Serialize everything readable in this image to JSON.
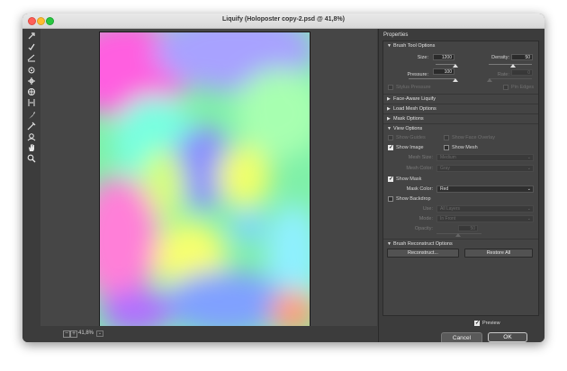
{
  "window": {
    "title": "Liquify (Holoposter copy-2.psd @ 41,8%)"
  },
  "toolbar": {
    "tools": [
      "forward-warp-tool",
      "reconstruct-tool",
      "smooth-tool",
      "twirl-clockwise-tool",
      "pucker-tool",
      "bloat-tool",
      "push-left-tool",
      "freeze-mask-tool",
      "thaw-mask-tool",
      "face-tool",
      "hand-tool",
      "zoom-tool"
    ]
  },
  "status": {
    "zoom": "41,8%",
    "zoom_out": "−",
    "zoom_in": "+",
    "dropdown": "⌄"
  },
  "properties": {
    "title": "Properties",
    "brush_tool_options": {
      "label": "Brush Tool Options",
      "size_label": "Size:",
      "size": "1200",
      "density_label": "Density:",
      "density": "50",
      "pressure_label": "Pressure:",
      "pressure": "100",
      "rate_label": "Rate:",
      "rate": "0",
      "stylus_pressure": "Stylus Pressure",
      "pin_edges": "Pin Edges"
    },
    "face_aware": "Face-Aware Liquify",
    "load_mesh": "Load Mesh Options",
    "mask_options": "Mask Options",
    "view_options": {
      "label": "View Options",
      "show_guides": "Show Guides",
      "show_face_overlay": "Show Face Overlay",
      "show_image": "Show Image",
      "show_mesh": "Show Mesh",
      "mesh_size_label": "Mesh Size:",
      "mesh_size": "Medium",
      "mesh_color_label": "Mesh Color:",
      "mesh_color": "Gray",
      "show_mask": "Show Mask",
      "mask_color_label": "Mask Color:",
      "mask_color": "Red",
      "show_backdrop": "Show Backdrop",
      "use_label": "Use:",
      "use": "All Layers",
      "mode_label": "Mode:",
      "mode": "In Front",
      "opacity_label": "Opacity:",
      "opacity": "50"
    },
    "brush_reconstruct": {
      "label": "Brush Reconstruct Options",
      "reconstruct": "Reconstruct...",
      "restore_all": "Restore All"
    },
    "preview": "Preview",
    "cancel": "Cancel",
    "ok": "OK"
  },
  "colors": {
    "panel_bg": "#444444",
    "window_bg": "#3c3c3c",
    "canvas_bg": "#464646"
  }
}
